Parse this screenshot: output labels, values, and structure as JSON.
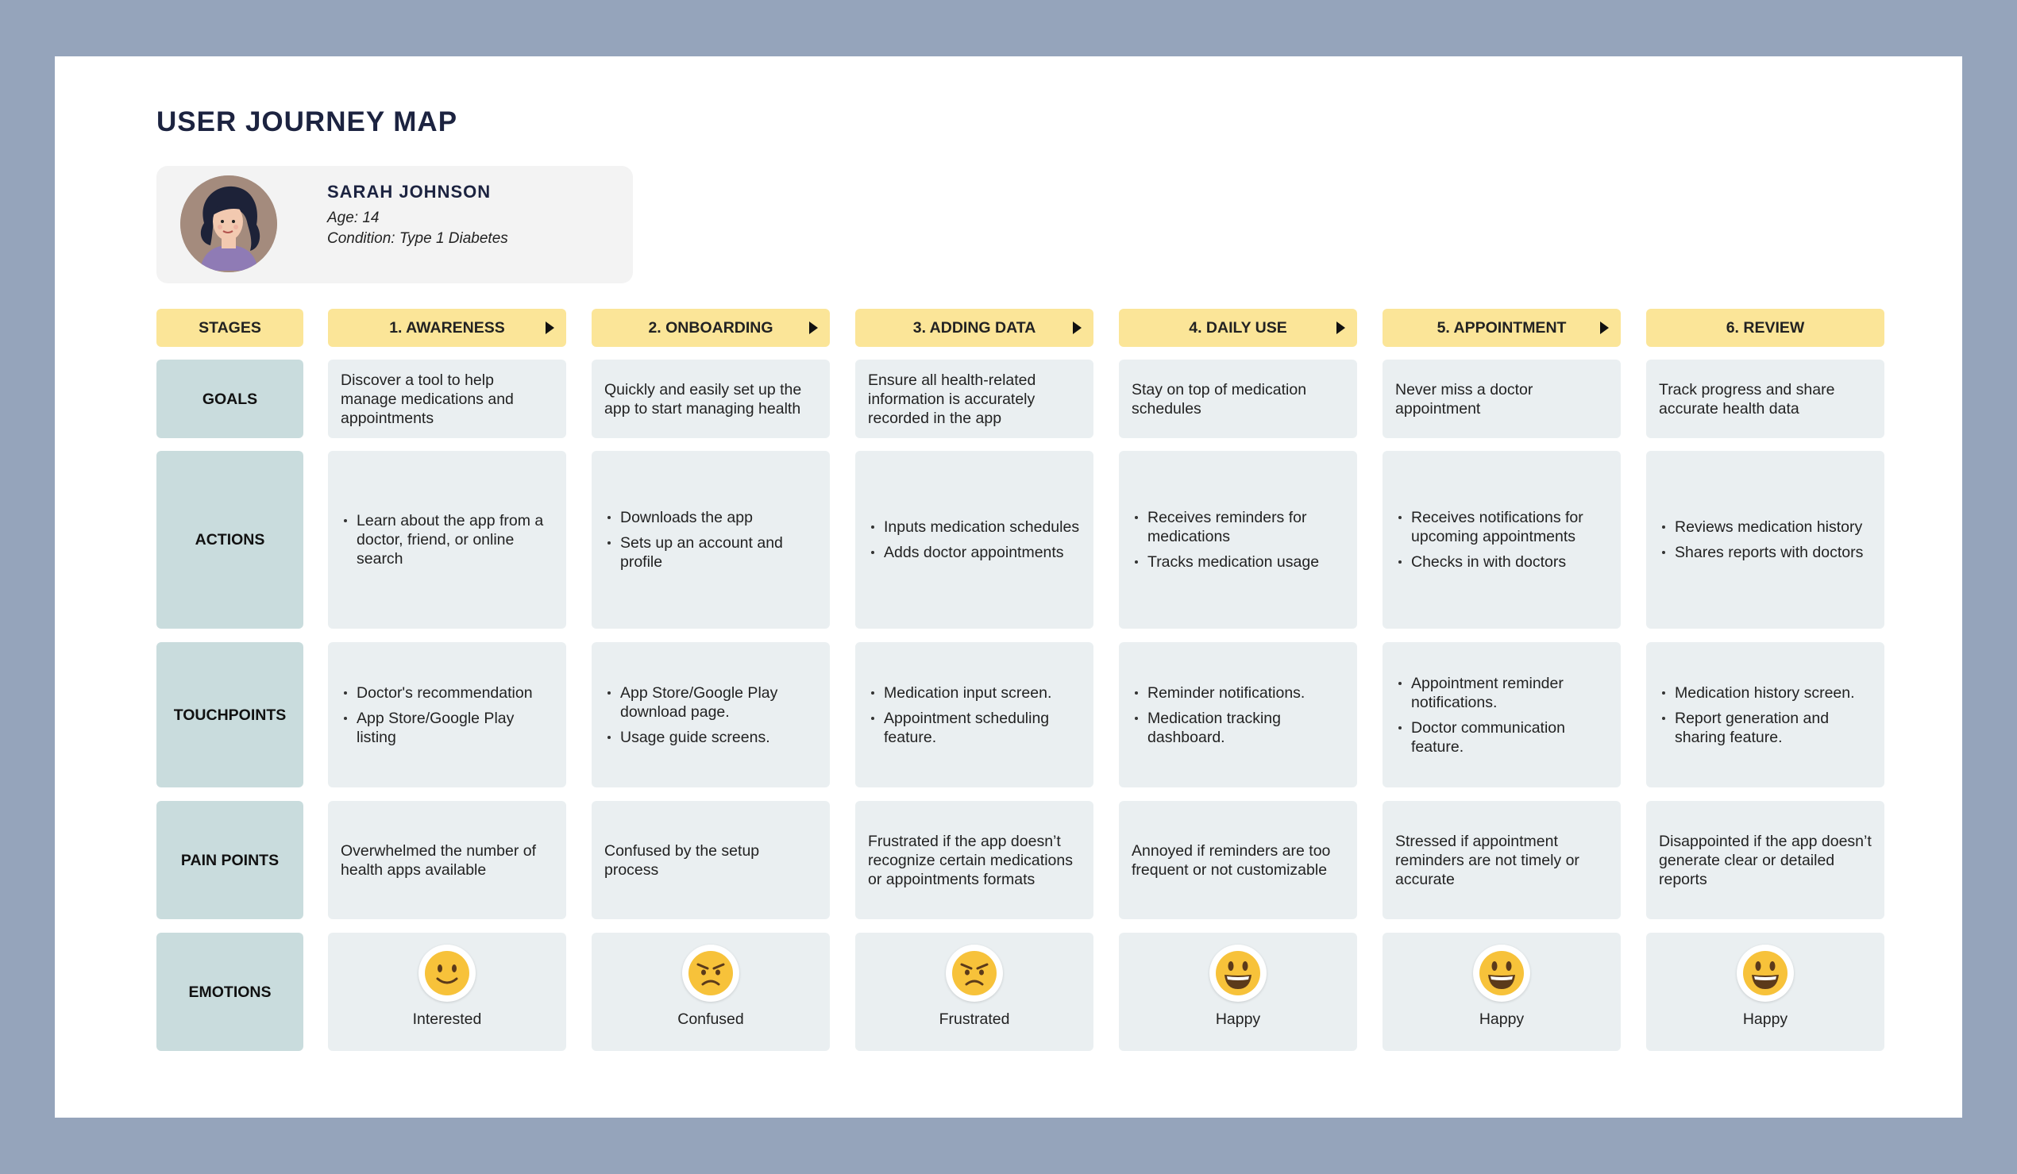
{
  "title": "USER JOURNEY MAP",
  "persona": {
    "name": "SARAH JOHNSON",
    "age": "Age: 14",
    "condition": "Condition: Type 1 Diabetes"
  },
  "row_labels": {
    "stages": "STAGES",
    "goals": "GOALS",
    "actions": "ACTIONS",
    "touchpoints": "TOUCHPOINTS",
    "pain_points": "PAIN POINTS",
    "emotions": "EMOTIONS"
  },
  "stages": [
    {
      "name": "1. AWARENESS",
      "goal": "Discover a tool to help manage medications and appointments",
      "actions": [
        "Learn about the app from a doctor, friend, or online search"
      ],
      "touchpoints": [
        "Doctor's recommendation",
        "App Store/Google Play listing"
      ],
      "pain_point": "Overwhelmed the number of health apps available",
      "emotion": "Interested",
      "emotion_icon": "slight-smile-icon"
    },
    {
      "name": "2. ONBOARDING",
      "goal": "Quickly and easily set up the app to start managing health",
      "actions": [
        "Downloads the app",
        "Sets up an account and profile"
      ],
      "touchpoints": [
        "App Store/Google Play download page.",
        "Usage guide screens."
      ],
      "pain_point": "Confused by the setup process",
      "emotion": "Confused",
      "emotion_icon": "angry-face-icon"
    },
    {
      "name": "3. ADDING DATA",
      "goal": "Ensure all health-related information is accurately recorded in the app",
      "actions": [
        "Inputs medication schedules",
        "Adds doctor appointments"
      ],
      "touchpoints": [
        "Medication input screen.",
        "Appointment scheduling feature."
      ],
      "pain_point": "Frustrated if the app doesn’t recognize certain medications or appointments formats",
      "emotion": "Frustrated",
      "emotion_icon": "angry-face-icon"
    },
    {
      "name": "4. DAILY USE",
      "goal": "Stay on top of medication schedules",
      "actions": [
        "Receives reminders for medications",
        "Tracks medication usage"
      ],
      "touchpoints": [
        "Reminder notifications.",
        "Medication tracking dashboard."
      ],
      "pain_point": "Annoyed if reminders are too frequent or not customizable",
      "emotion": "Happy",
      "emotion_icon": "grinning-face-icon"
    },
    {
      "name": "5. APPOINTMENT",
      "goal": "Never miss a doctor appointment",
      "actions": [
        "Receives notifications for upcoming appointments",
        "Checks in with doctors"
      ],
      "touchpoints": [
        "Appointment reminder notifications.",
        "Doctor communication feature."
      ],
      "pain_point": "Stressed if appointment reminders are not timely or accurate",
      "emotion": "Happy",
      "emotion_icon": "grinning-face-icon"
    },
    {
      "name": "6. REVIEW",
      "goal": "Track progress and share accurate health data",
      "actions": [
        "Reviews medication history",
        "Shares reports with doctors"
      ],
      "touchpoints": [
        "Medication history screen.",
        "Report generation and sharing feature."
      ],
      "pain_point": "Disappointed if the app doesn’t generate clear or detailed reports",
      "emotion": "Happy",
      "emotion_icon": "grinning-face-icon"
    }
  ],
  "colors": {
    "background": "#95a4bb",
    "stage_header": "#fbe598",
    "row_label": "#c9dcdd",
    "cell": "#eaeff1",
    "title": "#1c2340",
    "emoji": "#f7c23a"
  }
}
